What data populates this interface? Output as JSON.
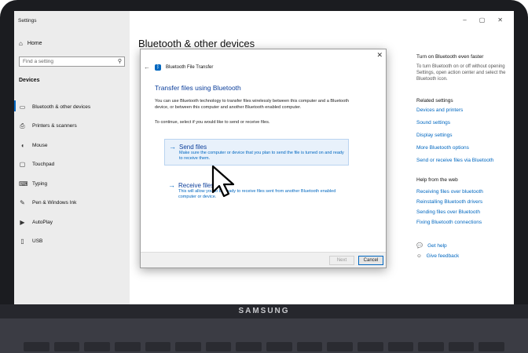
{
  "window": {
    "title": "Settings",
    "controls": [
      "–",
      "▢",
      "✕"
    ]
  },
  "sidebar": {
    "home": "Home",
    "search_placeholder": "Find a setting",
    "section": "Devices",
    "items": [
      {
        "label": "Bluetooth & other devices",
        "icon": "bluetooth-devices-icon"
      },
      {
        "label": "Printers & scanners",
        "icon": "printer-icon"
      },
      {
        "label": "Mouse",
        "icon": "mouse-icon"
      },
      {
        "label": "Touchpad",
        "icon": "touchpad-icon"
      },
      {
        "label": "Typing",
        "icon": "keyboard-icon"
      },
      {
        "label": "Pen & Windows Ink",
        "icon": "pen-icon"
      },
      {
        "label": "AutoPlay",
        "icon": "autoplay-icon"
      },
      {
        "label": "USB",
        "icon": "usb-icon"
      }
    ]
  },
  "main": {
    "title": "Bluetooth & other devices"
  },
  "right_panel": {
    "turn_on_heading": "Turn on Bluetooth even faster",
    "turn_on_text": "To turn Bluetooth on or off without opening Settings, open action center and select the Bluetooth icon.",
    "related_heading": "Related settings",
    "related_links": [
      "Devices and printers",
      "Sound settings",
      "Display settings",
      "More Bluetooth options",
      "Send or receive files via Bluetooth"
    ],
    "help_heading": "Help from the web",
    "help_links": [
      "Receiving files over bluetooth",
      "Reinstalling Bluetooth drivers",
      "Sending files over Bluetooth",
      "Fixing Bluetooth connections"
    ],
    "get_help": "Get help",
    "give_feedback": "Give feedback"
  },
  "dialog": {
    "window_title": "Bluetooth File Transfer",
    "close": "✕",
    "heading": "Transfer files using Bluetooth",
    "description": "You can use Bluetooth technology to transfer files wirelessly between this computer and a Bluetooth device, or between this computer and another Bluetooth enabled computer.",
    "instruction": "To continue, select if you would like to send or receive files.",
    "send_title": "Send files",
    "send_desc": "Make sure the computer or device that you plan to send the file is turned on and ready to receive them.",
    "receive_title": "Receive files",
    "receive_desc": "This will allow you to be ready to receive files sent from another Bluetooth enabled computer or device.",
    "next": "Next",
    "cancel": "Cancel"
  },
  "laptop": {
    "brand": "SAMSUNG"
  }
}
